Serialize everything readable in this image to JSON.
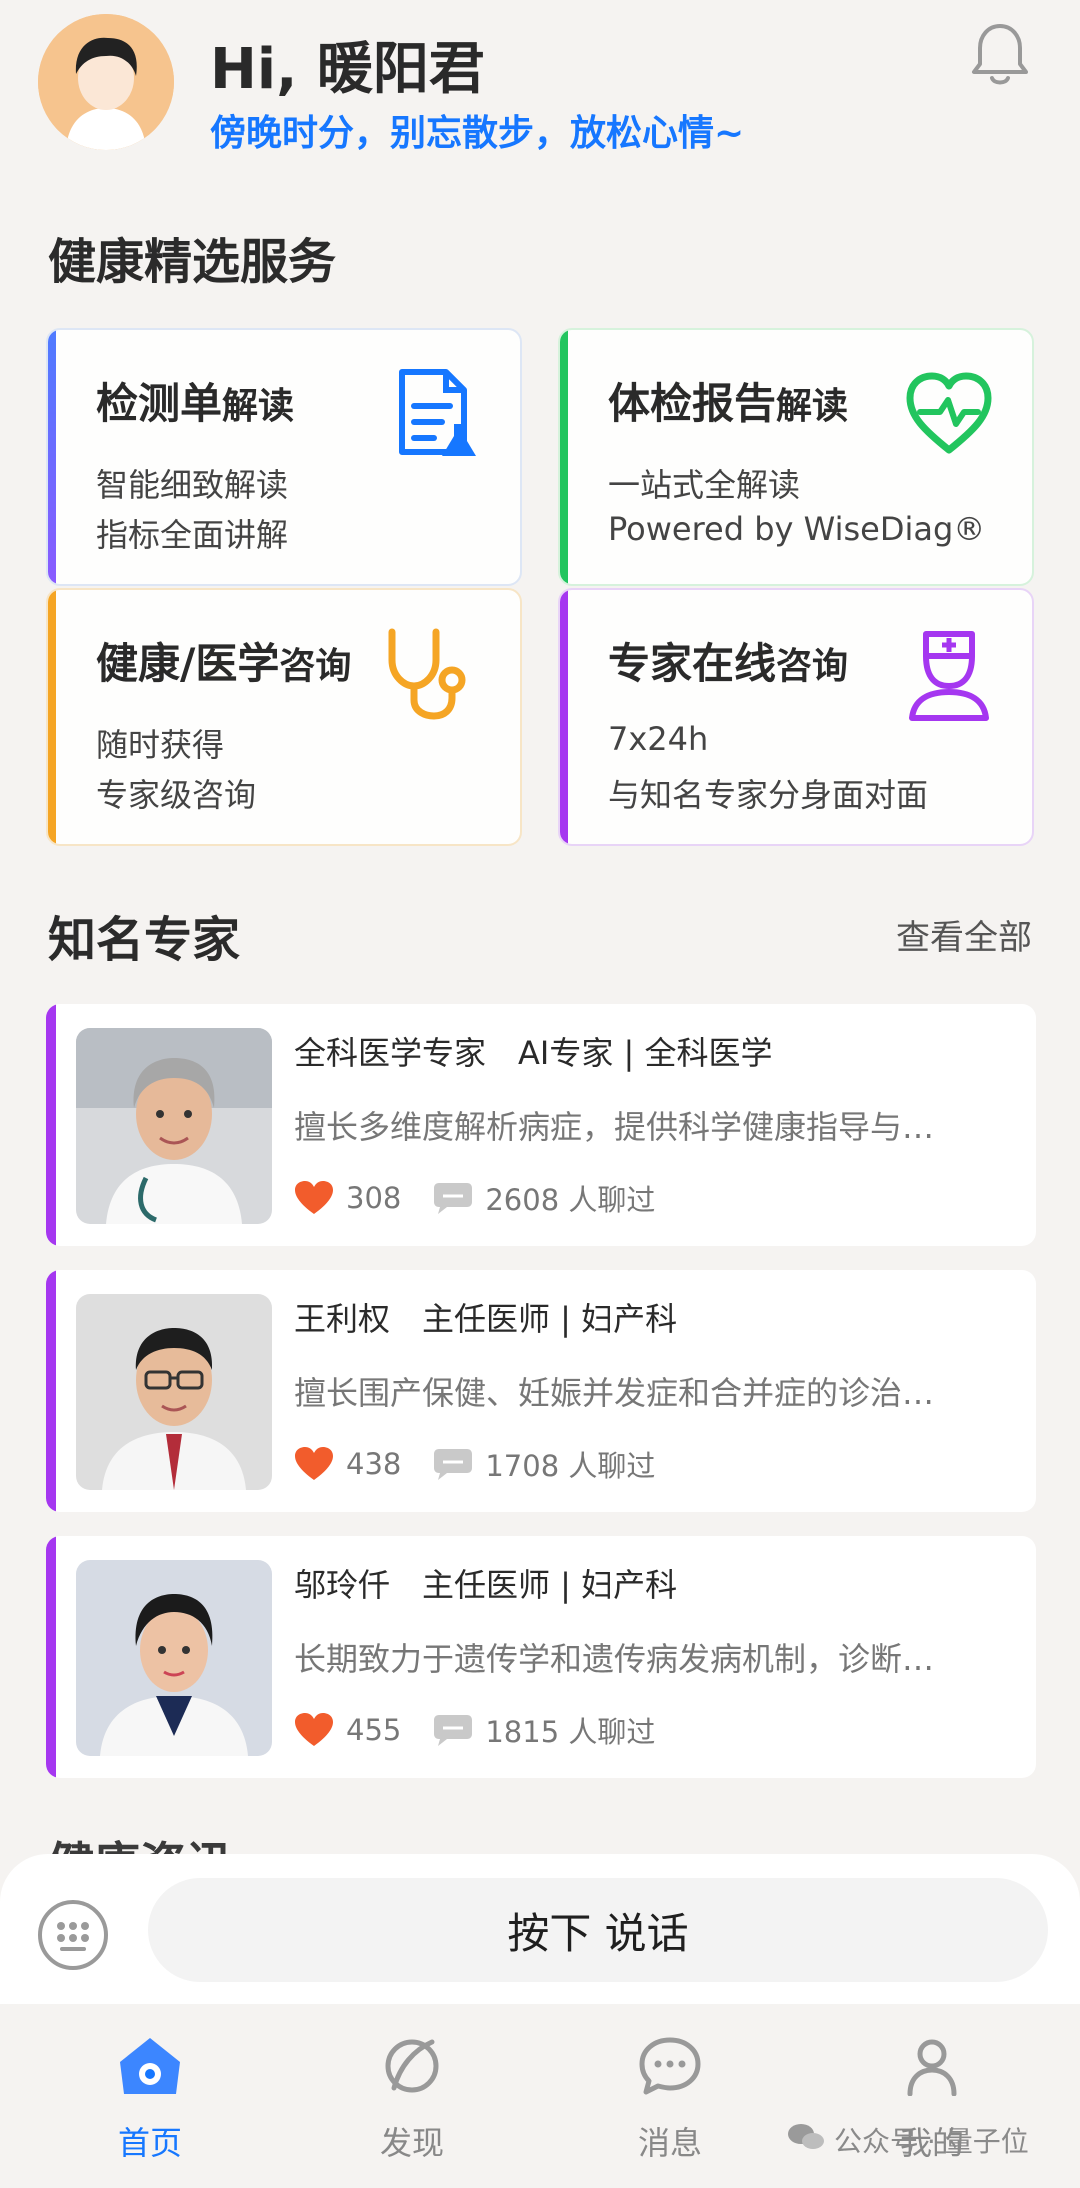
{
  "header": {
    "greeting": "Hi, 暖阳君",
    "tip": "傍晚时分，别忘散步，放松心情~",
    "bell_icon": "bell-icon"
  },
  "services": {
    "title": "健康精选服务",
    "items": [
      {
        "title_main": "检测单",
        "title_small": "解读",
        "line1": "智能细致解读",
        "line2": "指标全面讲解",
        "icon": "document-flask-icon",
        "color": "#1677ff"
      },
      {
        "title_main": "体检报告",
        "title_small": "解读",
        "line1": "一站式全解读",
        "line2": "Powered by WiseDiag®",
        "icon": "heart-pulse-icon",
        "color": "#22c55e"
      },
      {
        "title_main": "健康/医学",
        "title_small": "咨询",
        "line1": "随时获得",
        "line2": "专家级咨询",
        "icon": "stethoscope-icon",
        "color": "#f5a524"
      },
      {
        "title_main": "专家在线",
        "title_small": "咨询",
        "line1": "7x24h",
        "line2": "与知名专家分身面对面",
        "icon": "doctor-icon",
        "color": "#a537f0"
      }
    ]
  },
  "experts": {
    "title": "知名专家",
    "see_all": "查看全部",
    "items": [
      {
        "name": "全科医学专家　AI专家 | 全科医学",
        "desc": "擅长多维度解析病症，提供科学健康指导与…",
        "likes": "308",
        "chats": "2608 人聊过",
        "photo": "doctor-gray-hair-photo"
      },
      {
        "name": "王利权　主任医师 | 妇产科",
        "desc": "擅长围产保健、妊娠并发症和合并症的诊治…",
        "likes": "438",
        "chats": "1708 人聊过",
        "photo": "doctor-glasses-photo"
      },
      {
        "name": "邬玲仟　主任医师 | 妇产科",
        "desc": "长期致力于遗传学和遗传病发病机制，诊断…",
        "likes": "455",
        "chats": "1815 人聊过",
        "photo": "doctor-female-photo"
      }
    ]
  },
  "news": {
    "title": "健康资讯"
  },
  "voice": {
    "button": "按下 说话",
    "keyboard_icon": "keyboard-icon"
  },
  "tabbar": {
    "items": [
      {
        "label": "首页",
        "icon": "home-icon",
        "active": true
      },
      {
        "label": "发现",
        "icon": "discover-icon",
        "active": false
      },
      {
        "label": "消息",
        "icon": "message-icon",
        "active": false
      },
      {
        "label": "我的",
        "icon": "profile-icon",
        "active": false
      }
    ]
  },
  "watermark": "公众号 · 量子位",
  "colors": {
    "accent": "#1677ff",
    "like": "#f25c2c",
    "expert_bar": "#a537f0"
  }
}
